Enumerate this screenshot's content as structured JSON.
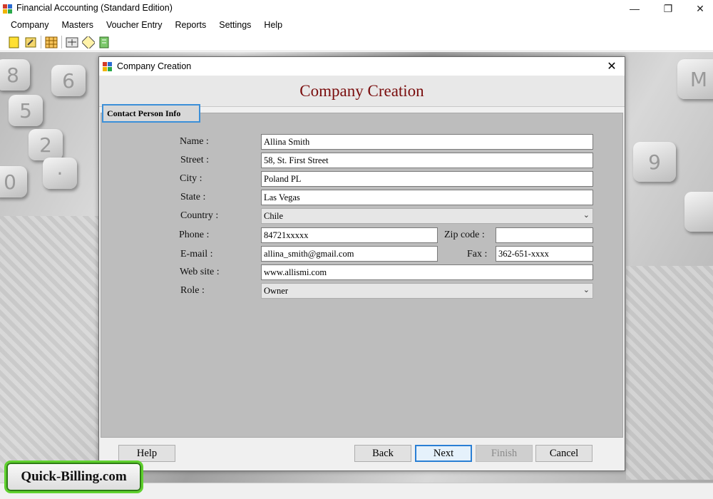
{
  "window": {
    "title": "Financial Accounting (Standard Edition)",
    "minimize": "—",
    "maximize": "❐",
    "close": "✕"
  },
  "menu": [
    "Company",
    "Masters",
    "Voucher Entry",
    "Reports",
    "Settings",
    "Help"
  ],
  "toolbar": {
    "buttons": [
      "new-company-icon",
      "open-company-icon",
      "calculator-icon",
      "ledger-icon",
      "voucher-icon",
      "export-icon"
    ]
  },
  "dialog": {
    "title": "Company Creation",
    "close": "✕",
    "heading": "Company Creation",
    "section": "Contact Person Info",
    "heading_color": "#7a0d0d"
  },
  "form": {
    "name": {
      "label": "Name :",
      "value": "Allina Smith"
    },
    "street": {
      "label": "Street :",
      "value": "58, St. First Street"
    },
    "city": {
      "label": "City :",
      "value": "Poland PL"
    },
    "state": {
      "label": "State :",
      "value": "Las Vegas"
    },
    "country": {
      "label": "Country :",
      "value": "Chile"
    },
    "phone": {
      "label": "Phone :",
      "value": "84721xxxxx"
    },
    "zip": {
      "label": "Zip code :",
      "value": ""
    },
    "email": {
      "label": "E-mail :",
      "value": "allina_smith@gmail.com"
    },
    "fax": {
      "label": "Fax :",
      "value": "362-651-xxxx"
    },
    "website": {
      "label": "Web site :",
      "value": "www.allismi.com"
    },
    "role": {
      "label": "Role :",
      "value": "Owner"
    }
  },
  "buttons": {
    "help": "Help",
    "back": "Back",
    "next": "Next",
    "finish": "Finish",
    "cancel": "Cancel"
  },
  "badge": "Quick-Billing.com",
  "colors": {
    "accent_blue": "#2a7fd4",
    "badge_green": "#5fd12e"
  }
}
